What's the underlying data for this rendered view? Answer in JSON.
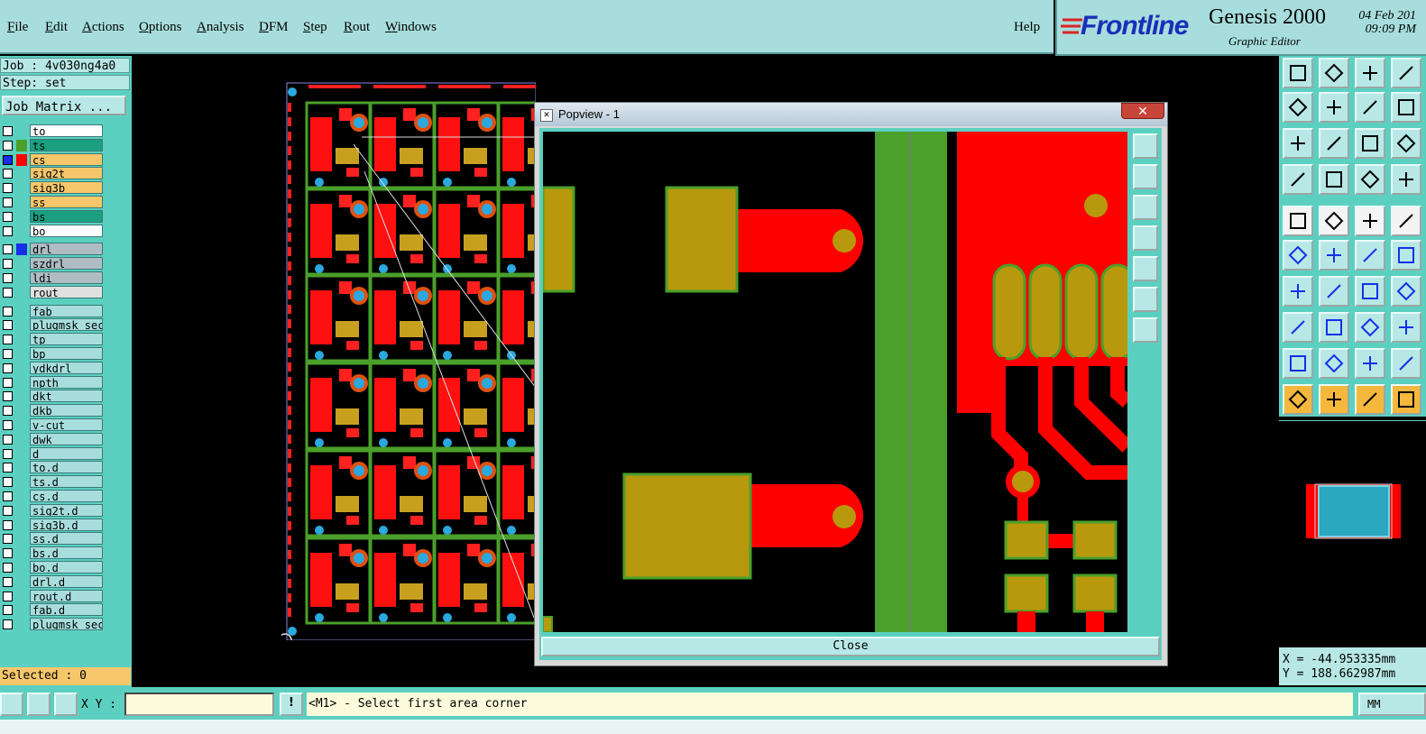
{
  "menu": {
    "items": [
      "File",
      "Edit",
      "Actions",
      "Options",
      "Analysis",
      "DFM",
      "Step",
      "Rout",
      "Windows"
    ],
    "help": "Help"
  },
  "brand": {
    "logo": "Frontline",
    "product": "Genesis 2000",
    "subtitle": "Graphic Editor",
    "date": "04 Feb 201",
    "time": "09:09 PM"
  },
  "job": {
    "job_label": "Job : 4v030ng4a0",
    "step_label": "Step: set",
    "matrix_button": "Job Matrix ...",
    "selected": "Selected : 0"
  },
  "layers": [
    {
      "name": "to",
      "color": "",
      "bg": "#ffffff",
      "checked": false
    },
    {
      "name": "ts",
      "color": "#4aa02a",
      "bg": "#1aa080",
      "checked": false
    },
    {
      "name": "cs",
      "color": "#ff0000",
      "bg": "#f5c76a",
      "checked": true
    },
    {
      "name": "sig2t",
      "color": "",
      "bg": "#f5c76a",
      "checked": false
    },
    {
      "name": "sig3b",
      "color": "",
      "bg": "#f5c76a",
      "checked": false
    },
    {
      "name": "ss",
      "color": "",
      "bg": "#f5c76a",
      "checked": false
    },
    {
      "name": "bs",
      "color": "",
      "bg": "#1aa080",
      "checked": false
    },
    {
      "name": "bo",
      "color": "",
      "bg": "#ffffff",
      "checked": false
    },
    {
      "name": "drl",
      "color": "#1530e8",
      "bg": "#b0bcc4",
      "checked": false
    },
    {
      "name": "szdrl",
      "color": "",
      "bg": "#b0bcc4",
      "checked": false
    },
    {
      "name": "ldi",
      "color": "",
      "bg": "#b0bcc4",
      "checked": false
    },
    {
      "name": "rout",
      "color": "",
      "bg": "#e0e0e0",
      "checked": false
    },
    {
      "name": "fab",
      "color": "",
      "bg": "#a7dedd",
      "checked": false
    },
    {
      "name": "plugmsk_sec",
      "color": "",
      "bg": "#a7dedd",
      "checked": false
    },
    {
      "name": "tp",
      "color": "",
      "bg": "#a7dedd",
      "checked": false
    },
    {
      "name": "bp",
      "color": "",
      "bg": "#a7dedd",
      "checked": false
    },
    {
      "name": "ydkdrl",
      "color": "",
      "bg": "#a7dedd",
      "checked": false
    },
    {
      "name": "npth",
      "color": "",
      "bg": "#a7dedd",
      "checked": false
    },
    {
      "name": "dkt",
      "color": "",
      "bg": "#a7dedd",
      "checked": false
    },
    {
      "name": "dkb",
      "color": "",
      "bg": "#a7dedd",
      "checked": false
    },
    {
      "name": "v-cut",
      "color": "",
      "bg": "#a7dedd",
      "checked": false
    },
    {
      "name": "dwk",
      "color": "",
      "bg": "#a7dedd",
      "checked": false
    },
    {
      "name": "d",
      "color": "",
      "bg": "#a7dedd",
      "checked": false
    },
    {
      "name": "to.d",
      "color": "",
      "bg": "#a7dedd",
      "checked": false
    },
    {
      "name": "ts.d",
      "color": "",
      "bg": "#a7dedd",
      "checked": false
    },
    {
      "name": "cs.d",
      "color": "",
      "bg": "#a7dedd",
      "checked": false
    },
    {
      "name": "sig2t.d",
      "color": "",
      "bg": "#a7dedd",
      "checked": false
    },
    {
      "name": "sig3b.d",
      "color": "",
      "bg": "#a7dedd",
      "checked": false
    },
    {
      "name": "ss.d",
      "color": "",
      "bg": "#a7dedd",
      "checked": false
    },
    {
      "name": "bs.d",
      "color": "",
      "bg": "#a7dedd",
      "checked": false
    },
    {
      "name": "bo.d",
      "color": "",
      "bg": "#a7dedd",
      "checked": false
    },
    {
      "name": "drl.d",
      "color": "",
      "bg": "#a7dedd",
      "checked": false
    },
    {
      "name": "rout.d",
      "color": "",
      "bg": "#a7dedd",
      "checked": false
    },
    {
      "name": "fab.d",
      "color": "",
      "bg": "#a7dedd",
      "checked": false
    },
    {
      "name": "plugmsk_sec",
      "color": "",
      "bg": "#a7dedd",
      "checked": false
    }
  ],
  "popview": {
    "title": "Popview - 1",
    "close_x": "✕",
    "close_button": "Close"
  },
  "coords": {
    "x": "X = -44.953335mm",
    "y": "Y = 188.662987mm"
  },
  "status": {
    "xy_label": "X Y :",
    "xy_value": "",
    "excl": "!",
    "prompt": "<M1> - Select first area corner",
    "units": "MM"
  },
  "colors": {
    "panel_teal": "#5cd0c0",
    "copper_red": "#ff0000",
    "pad_gold": "#b8980c",
    "mask_green": "#4aa02a"
  }
}
